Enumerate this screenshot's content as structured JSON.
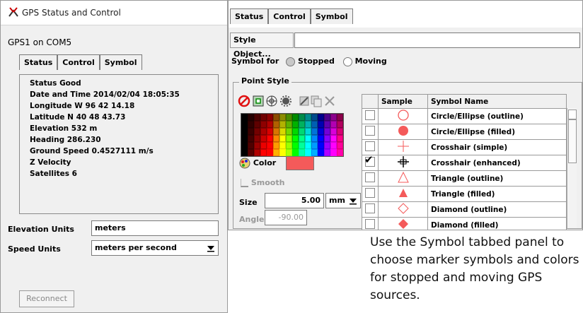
{
  "window": {
    "title": "GPS Status and Control",
    "gps_label": "GPS1 on COM5",
    "tabs": [
      "Status",
      "Control",
      "Symbol"
    ],
    "status": {
      "lines": [
        "Status   Good",
        "Date and Time   2014/02/04  18:05:35",
        "Longitude   W 96 42 14.18",
        "Latitude   N 40 48 43.73",
        "Elevation    532  m",
        "Heading   286.230",
        "Ground Speed   0.4527111  m/s",
        "Z Velocity",
        "Satellites  6"
      ]
    },
    "elevation_units": {
      "label": "Elevation Units",
      "value": "meters"
    },
    "speed_units": {
      "label": "Speed Units",
      "value": "meters per second"
    },
    "reconnect_label": "Reconnect"
  },
  "symbol_panel": {
    "tabs": [
      "Status",
      "Control",
      "Symbol"
    ],
    "style_object_label": "Style Object...",
    "symbol_for_label": "Symbol for",
    "stopped_label": "Stopped",
    "moving_label": "Moving",
    "point_style_label": "Point Style",
    "color_label": "Color",
    "color_value": "#f45a5a",
    "smooth_label": "Smooth",
    "size_label": "Size",
    "size_value": "5.00",
    "size_unit": "mm",
    "angle_label": "Angle",
    "angle_value": "-90.00",
    "table": {
      "headers": [
        "Sample",
        "Symbol Name"
      ],
      "rows": [
        {
          "name": "Circle/Ellipse (outline)",
          "checked": false,
          "icon": "circle-outline"
        },
        {
          "name": "Circle/Ellipse (filled)",
          "checked": false,
          "icon": "circle-filled"
        },
        {
          "name": "Crosshair (simple)",
          "checked": false,
          "icon": "crosshair-simple"
        },
        {
          "name": "Crosshair (enhanced)",
          "checked": true,
          "icon": "crosshair-enhanced"
        },
        {
          "name": "Triangle (outline)",
          "checked": false,
          "icon": "triangle-outline"
        },
        {
          "name": "Triangle (filled)",
          "checked": false,
          "icon": "triangle-filled"
        },
        {
          "name": "Diamond (outline)",
          "checked": false,
          "icon": "diamond-outline"
        },
        {
          "name": "Diamond (filled)",
          "checked": false,
          "icon": "diamond-filled"
        }
      ]
    }
  },
  "caption": "Use the Symbol tabbed panel to choose marker symbols and colors for stopped and moving GPS sources."
}
